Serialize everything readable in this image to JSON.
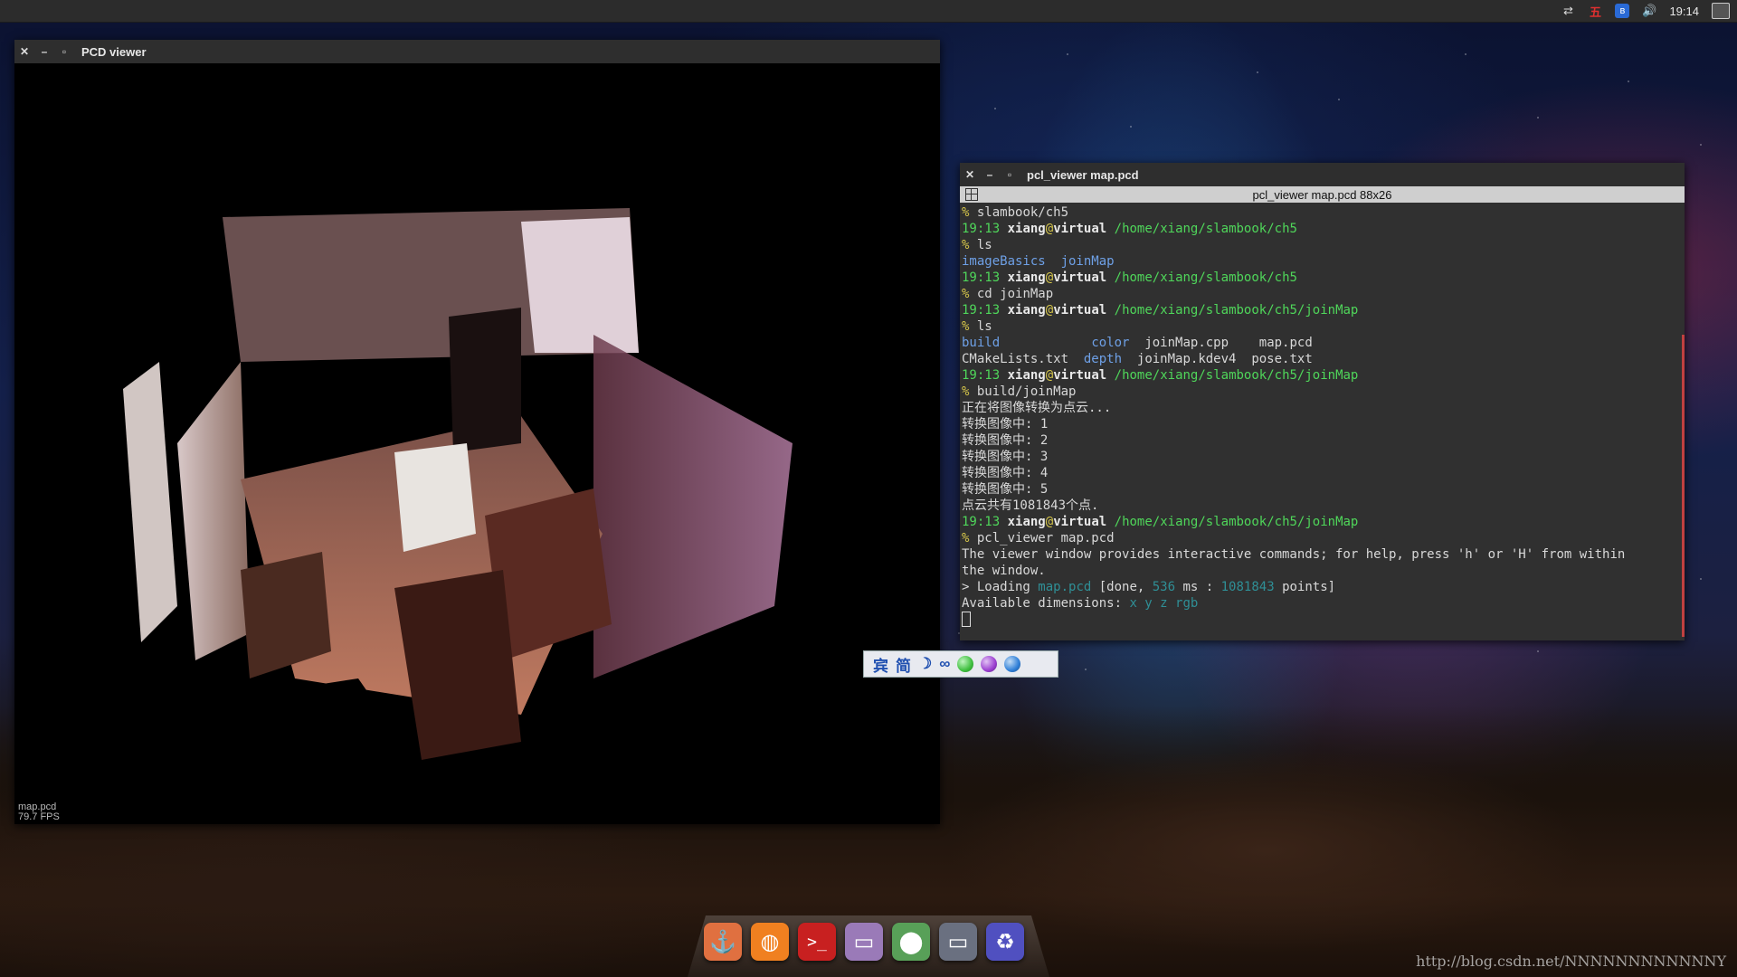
{
  "panel": {
    "clock": "19:14",
    "wubi_label": "五",
    "bluetooth_label": "ʙ"
  },
  "pcd_window": {
    "title": "PCD viewer",
    "close": "✕",
    "minimize": "–",
    "maximize": "▫",
    "cloud_name": "map.pcd",
    "fps": "79.7 FPS"
  },
  "terminal": {
    "title": "pcl_viewer map.pcd",
    "close": "✕",
    "minimize": "–",
    "maximize": "▫",
    "tab_title": "pcl_viewer map.pcd 88x26",
    "prompt_time": "19:13",
    "user": "xiang",
    "at": "@",
    "host": "virtual",
    "lines": {
      "l1_cmd": "slambook/ch5",
      "l2_path": "/home/xiang/slambook/ch5",
      "l3_cmd": "ls",
      "l4_dir1": "imageBasics",
      "l4_dir2": "joinMap",
      "l5_path": "/home/xiang/slambook/ch5",
      "l6_cmd": "cd joinMap",
      "l7_path": "/home/xiang/slambook/ch5/joinMap",
      "l8_cmd": "ls",
      "ls_build": "build",
      "ls_color": "color",
      "ls_joinmap_cpp": "joinMap.cpp",
      "ls_map_pcd": "map.pcd",
      "ls_cmakelists": "CMakeLists.txt",
      "ls_depth": "depth",
      "ls_kdev": "joinMap.kdev4",
      "ls_pose": "pose.txt",
      "l11_path": "/home/xiang/slambook/ch5/joinMap",
      "l12_cmd": "build/joinMap",
      "l13": "正在将图像转换为点云...",
      "l14": "转换图像中: 1",
      "l15": "转换图像中: 2",
      "l16": "转换图像中: 3",
      "l17": "转换图像中: 4",
      "l18": "转换图像中: 5",
      "l19": "点云共有1081843个点.",
      "l20_path": "/home/xiang/slambook/ch5/joinMap",
      "l21_cmd": "pcl_viewer map.pcd",
      "l22": "The viewer window provides interactive commands; for help, press 'h' or 'H' from within",
      "l23": "the window.",
      "l24_a": "> Loading ",
      "l24_file": "map.pcd",
      "l24_b": " [done, ",
      "l24_ms": "536",
      "l24_c": " ms : ",
      "l24_pts": "1081843",
      "l24_d": " points]",
      "l25_a": "Available dimensions: ",
      "l25_dims": "x y z rgb"
    },
    "prompt_symbol": "%"
  },
  "ime": {
    "logo": "宾",
    "mode": "简",
    "moon": "☽",
    "link": "∞",
    "colors": [
      "#3fbf3f",
      "#9b3fd0",
      "#2f7fd8"
    ]
  },
  "dock": {
    "items": [
      {
        "name": "anchor-app",
        "glyph": "⚓",
        "color": "#e07040"
      },
      {
        "name": "firefox",
        "glyph": "◍",
        "color": "#f08020"
      },
      {
        "name": "terminal-app",
        "glyph": ">_",
        "color": "#c82020"
      },
      {
        "name": "files",
        "glyph": "▭",
        "color": "#9a7ab8"
      },
      {
        "name": "install-app",
        "glyph": "⬤",
        "color": "#58a058"
      },
      {
        "name": "window-app",
        "glyph": "▭",
        "color": "#6a7080"
      },
      {
        "name": "trash",
        "glyph": "♻",
        "color": "#5050c0"
      }
    ]
  },
  "watermark": "http://blog.csdn.net/NNNNNNNNNNNNY"
}
